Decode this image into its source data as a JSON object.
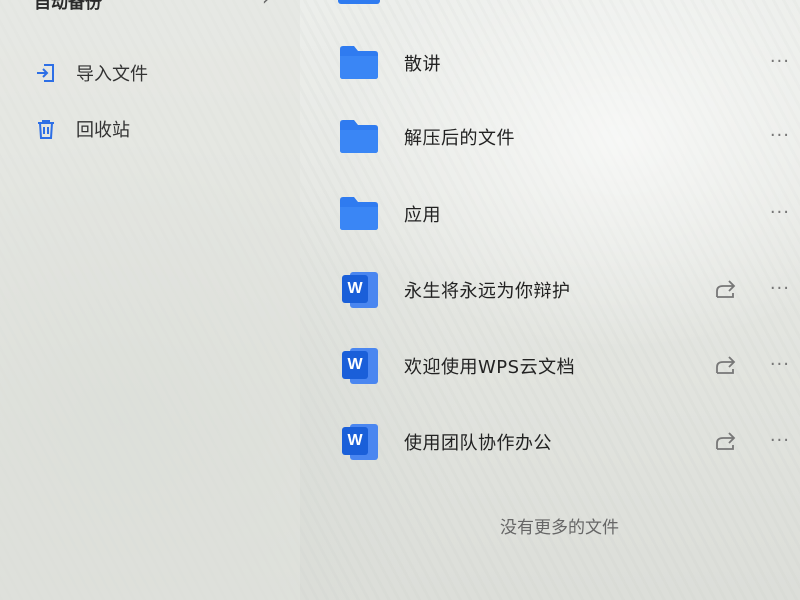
{
  "sidebar": {
    "top_label": "自动备份",
    "items": [
      {
        "label": "导入文件",
        "icon": "import-icon"
      },
      {
        "label": "回收站",
        "icon": "trash-icon"
      }
    ]
  },
  "files": [
    {
      "name": "散讲",
      "type": "folder"
    },
    {
      "name": "解压后的文件",
      "type": "folder"
    },
    {
      "name": "应用",
      "type": "folder"
    },
    {
      "name": "永生将永远为你辩护",
      "type": "word",
      "shared": true
    },
    {
      "name": "欢迎使用WPS云文档",
      "type": "word",
      "shared": true
    },
    {
      "name": "使用团队协作办公",
      "type": "word",
      "shared": true
    }
  ],
  "word_badge": "W",
  "more_label": "···",
  "footer": {
    "text": "没有更多的文件"
  },
  "colors": {
    "folder": "#2f7bf0",
    "word_dark": "#1a5fd9",
    "word_light": "#4a86f0"
  }
}
